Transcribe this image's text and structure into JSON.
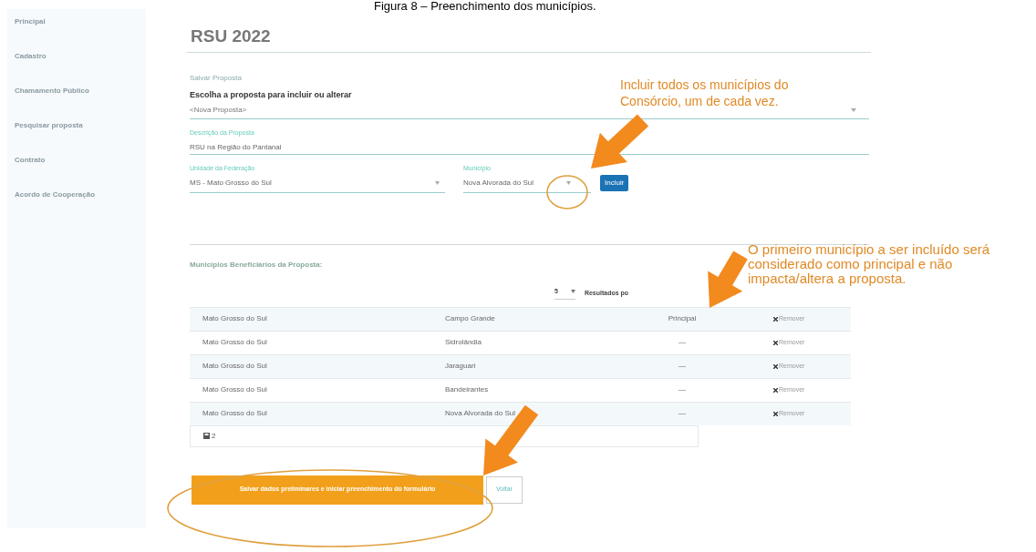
{
  "figure_caption": "Figura 8 – Preenchimento dos municípios.",
  "sidebar": {
    "items": [
      {
        "label": "Principal"
      },
      {
        "label": "Cadastro"
      },
      {
        "label": "Chamamento Público"
      },
      {
        "label": "Pesquisar proposta"
      },
      {
        "label": "Contrato"
      },
      {
        "label": "Acordo de Cooperação"
      }
    ]
  },
  "page_title": "RSU 2022",
  "form": {
    "section_title": "Salvar Proposta",
    "choose_label": "Escolha a proposta para incluir ou alterar",
    "proposal_select": {
      "value": "<Nova Proposta>"
    },
    "description": {
      "label": "Descrição da Proposta",
      "value": "RSU na Região do Pantanal"
    },
    "uf": {
      "label": "Unidade da Federação",
      "value": "MS - Mato Grosso do Sul"
    },
    "municipio": {
      "label": "Município",
      "value": "Nova Alvorada do Sul"
    },
    "include_button": "Incluir"
  },
  "beneficiaries": {
    "title": "Municípios Beneficiários da Proposta:",
    "page_size": "5",
    "page_size_label": "Resultados po",
    "rows": [
      {
        "uf": "Mato Grosso do Sul",
        "municipio": "Campo Grande",
        "principal": "Principal",
        "action": "Remover"
      },
      {
        "uf": "Mato Grosso do Sul",
        "municipio": "Sidrolândia",
        "principal": "—",
        "action": "Remover"
      },
      {
        "uf": "Mato Grosso do Sul",
        "municipio": "Jaraguari",
        "principal": "—",
        "action": "Remover"
      },
      {
        "uf": "Mato Grosso do Sul",
        "municipio": "Bandeirantes",
        "principal": "—",
        "action": "Remover"
      },
      {
        "uf": "Mato Grosso do Sul",
        "municipio": "Nova Alvorada do Sul",
        "principal": "—",
        "action": "Remover"
      }
    ],
    "footer": "2"
  },
  "buttons": {
    "primary": "Salvar dados preliminares e iniciar preenchimento do formulário",
    "secondary": "Voltar"
  },
  "annotations": [
    {
      "text": "Incluir todos os municípios do Consórcio, um de cada vez."
    },
    {
      "text": "O primeiro município a ser incluído será considerado como principal e não impacta/altera a proposta."
    }
  ]
}
